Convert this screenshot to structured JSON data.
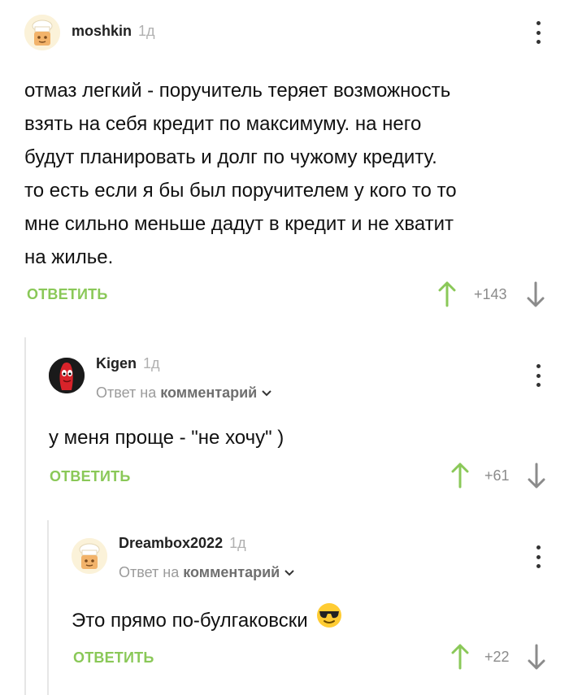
{
  "comments": [
    {
      "username": "moshkin",
      "age": "1д",
      "avatar": "chef-avatar",
      "text_lines": [
        "отмаз легкий - поручитель теряет возможность",
        "взять на себя кредит по максимуму. на него",
        "будут планировать и долг по чужому кредиту.",
        "то есть если я бы был поручителем у кого то то",
        "мне сильно меньше дадут в кредит и не хватит",
        "на жилье."
      ],
      "reply_label": "ОТВЕТИТЬ",
      "votes": "+143"
    },
    {
      "username": "Kigen",
      "age": "1д",
      "avatar": "red-creature-avatar",
      "reply_to_prefix": "Ответ на",
      "reply_to_link": "комментарий",
      "text": "у меня проще - \"не хочу\" )",
      "reply_label": "ОТВЕТИТЬ",
      "votes": "+61"
    },
    {
      "username": "Dreambox2022",
      "age": "1д",
      "avatar": "chef-avatar",
      "reply_to_prefix": "Ответ на",
      "reply_to_link": "комментарий",
      "text": "Это прямо по-булгаковски",
      "emoji": "sunglasses-emoji",
      "reply_label": "ОТВЕТИТЬ",
      "votes": "+22"
    }
  ],
  "colors": {
    "accent_green": "#8ac858",
    "thread_line": "#e6e6e6",
    "muted_text": "#9b9b9b"
  }
}
